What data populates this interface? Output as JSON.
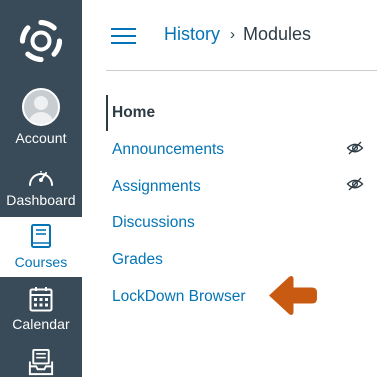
{
  "colors": {
    "nav_bg": "#394b58",
    "brand_blue": "#0374b5",
    "text_dark": "#2d3b45",
    "arrow_orange": "#c85a12"
  },
  "global_nav": {
    "logo_icon": "canvas-logo-icon",
    "items": [
      {
        "label": "Account",
        "icon": "user-avatar-icon",
        "active": false
      },
      {
        "label": "Dashboard",
        "icon": "speedometer-icon",
        "active": false
      },
      {
        "label": "Courses",
        "icon": "book-icon",
        "active": true
      },
      {
        "label": "Calendar",
        "icon": "calendar-icon",
        "active": false
      },
      {
        "label": "",
        "icon": "inbox-icon",
        "active": false
      }
    ]
  },
  "header": {
    "menu_icon": "hamburger-icon",
    "breadcrumb": {
      "course": "History",
      "separator_icon": "chevron-right-icon",
      "current": "Modules"
    }
  },
  "course_nav": {
    "items": [
      {
        "label": "Home",
        "active": true,
        "hidden_from_students": false
      },
      {
        "label": "Announcements",
        "active": false,
        "hidden_from_students": true
      },
      {
        "label": "Assignments",
        "active": false,
        "hidden_from_students": true
      },
      {
        "label": "Discussions",
        "active": false,
        "hidden_from_students": false
      },
      {
        "label": "Grades",
        "active": false,
        "hidden_from_students": false
      },
      {
        "label": "LockDown Browser",
        "active": false,
        "hidden_from_students": false
      }
    ],
    "hidden_icon": "eye-slash-icon"
  },
  "annotation": {
    "icon": "left-arrow-icon",
    "points_to": "LockDown Browser"
  }
}
